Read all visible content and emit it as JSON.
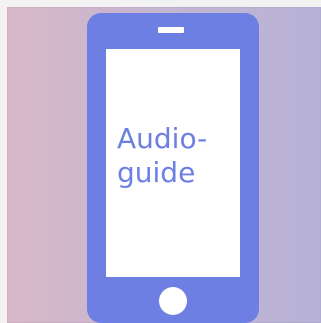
{
  "icon": {
    "name": "smartphone-icon",
    "screen_text": "Audio-\nguide"
  },
  "colors": {
    "accent": "#6d7fe3",
    "screen": "#ffffff",
    "background_left": "#d8b8c8",
    "background_right": "#b6b2d8"
  }
}
